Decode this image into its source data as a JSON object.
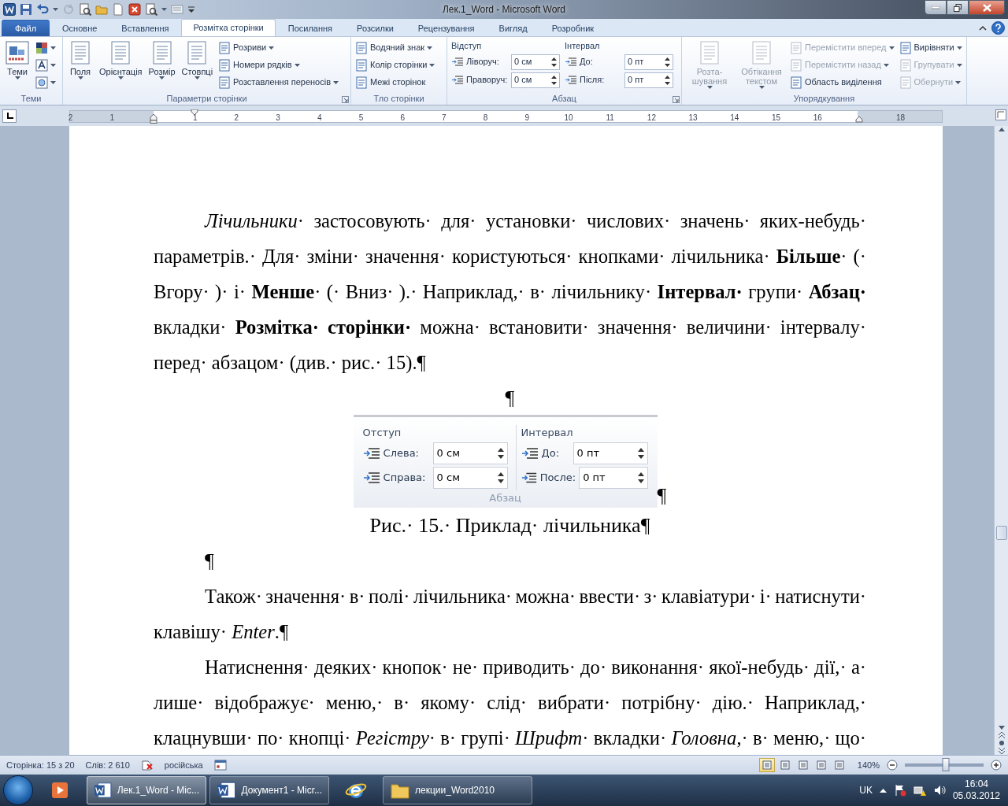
{
  "window": {
    "title": "Лек.1_Word - Microsoft Word"
  },
  "tabs": [
    {
      "label": "Файл",
      "kind": "file",
      "selected": false
    },
    {
      "label": "Основне",
      "kind": "tab",
      "selected": false
    },
    {
      "label": "Вставлення",
      "kind": "tab",
      "selected": false
    },
    {
      "label": "Розмітка сторінки",
      "kind": "tab",
      "selected": true
    },
    {
      "label": "Посилання",
      "kind": "tab",
      "selected": false
    },
    {
      "label": "Розсилки",
      "kind": "tab",
      "selected": false
    },
    {
      "label": "Рецензування",
      "kind": "tab",
      "selected": false
    },
    {
      "label": "Вигляд",
      "kind": "tab",
      "selected": false
    },
    {
      "label": "Розробник",
      "kind": "tab",
      "selected": false
    }
  ],
  "ribbon": {
    "groups": [
      {
        "label": "Теми",
        "launcher": false,
        "items": [
          {
            "kind": "large",
            "label": "Теми",
            "dropdown": true,
            "disabled": false
          },
          {
            "kind": "small",
            "dropdown": true,
            "disabled": false
          },
          {
            "kind": "small",
            "dropdown": true,
            "disabled": false
          },
          {
            "kind": "small",
            "dropdown": true,
            "disabled": false
          }
        ]
      },
      {
        "label": "Параметри сторінки",
        "launcher": true,
        "items": [
          {
            "kind": "large",
            "label": "Поля",
            "dropdown": true,
            "disabled": false
          },
          {
            "kind": "large",
            "label": "Орієнтація",
            "dropdown": true,
            "disabled": false
          },
          {
            "kind": "large",
            "label": "Розмір",
            "dropdown": true,
            "disabled": false
          },
          {
            "kind": "large",
            "label": "Стовпці",
            "dropdown": true,
            "disabled": false
          },
          {
            "kind": "small",
            "label": "Розриви",
            "dropdown": true,
            "disabled": false
          },
          {
            "kind": "small",
            "label": "Номери рядків",
            "dropdown": true,
            "disabled": false
          },
          {
            "kind": "small",
            "label": "Розставлення переносів",
            "dropdown": true,
            "disabled": false
          }
        ]
      },
      {
        "label": "Тло сторінки",
        "launcher": false,
        "items": [
          {
            "kind": "small",
            "label": "Водяний знак",
            "dropdown": true,
            "disabled": false
          },
          {
            "kind": "small",
            "label": "Колір сторінки",
            "dropdown": true,
            "disabled": false
          },
          {
            "kind": "small",
            "label": "Межі сторінок",
            "dropdown": false,
            "disabled": false
          }
        ]
      },
      {
        "label": "Абзац",
        "launcher": true,
        "items": [
          {
            "kind": "spin",
            "heading": "Відступ",
            "rows": [
              {
                "label": "Ліворуч:",
                "value": "0 см"
              },
              {
                "label": "Праворуч:",
                "value": "0 см"
              }
            ]
          },
          {
            "kind": "spin",
            "heading": "Інтервал",
            "rows": [
              {
                "label": "До:",
                "value": "0 пт"
              },
              {
                "label": "Після:",
                "value": "0 пт"
              }
            ]
          }
        ]
      },
      {
        "label": "Упорядкування",
        "launcher": false,
        "items": [
          {
            "kind": "large",
            "label": "Розта-шування",
            "dropdown": true,
            "disabled": true
          },
          {
            "kind": "large",
            "label": "Обтікання текстом",
            "dropdown": true,
            "disabled": true
          },
          {
            "kind": "small",
            "label": "Перемістити вперед",
            "dropdown": true,
            "disabled": true
          },
          {
            "kind": "small",
            "label": "Перемістити назад",
            "dropdown": true,
            "disabled": true
          },
          {
            "kind": "small",
            "label": "Область виділення",
            "dropdown": false,
            "disabled": false
          },
          {
            "kind": "small",
            "label": "Вирівняти",
            "dropdown": true,
            "disabled": false
          },
          {
            "kind": "small",
            "label": "Групувати",
            "dropdown": true,
            "disabled": true
          },
          {
            "kind": "small",
            "label": "Обернути",
            "dropdown": true,
            "disabled": true
          }
        ]
      }
    ]
  },
  "ruler": {
    "labels": [
      "2",
      "1",
      "1",
      "2",
      "3",
      "4",
      "5",
      "6",
      "7",
      "8",
      "9",
      "10",
      "11",
      "12",
      "13",
      "14",
      "15",
      "16",
      "18"
    ]
  },
  "document": {
    "paragraphs": [
      {
        "kind": "body",
        "continues": false,
        "lines": [
          "*Лічильники*· застосовують· для· установки· числових· значень· яких-небудь·",
          "параметрів.· Для· зміни· значення· користуються· кнопками· лічильника· **Більше**· (·",
          "Вгору· )· і· **Менше**· (· Вниз· ).· Наприклад,· в· лічильнику· **Інтервал·** групи· **Абзац·**",
          "вкладки· **Розмітка· сторінки·** можна· встановити· значення· величини· інтервалу·",
          "перед· абзацом· (див.· рис.· 15).¶"
        ]
      },
      {
        "kind": "mark",
        "text": "¶"
      },
      {
        "kind": "figure",
        "mark": "¶",
        "group_label": "Абзац",
        "columns": [
          {
            "heading": "Отступ",
            "rows": [
              {
                "label": "Слева:",
                "value": "0 см"
              },
              {
                "label": "Справа:",
                "value": "0 см"
              }
            ]
          },
          {
            "heading": "Интервал",
            "rows": [
              {
                "label": "До:",
                "value": "0 пт"
              },
              {
                "label": "После:",
                "value": "0 пт"
              }
            ]
          }
        ]
      },
      {
        "kind": "caption",
        "text": "Рис.· 15.· Приклад· лічильника¶"
      },
      {
        "kind": "indent_mark",
        "text": "¶"
      },
      {
        "kind": "body",
        "continues": false,
        "lines": [
          "Також· значення· в· полі· лічильника· можна· ввести· з· клавіатури· і· натиснути·",
          "клавішу· *Enter*.¶"
        ]
      },
      {
        "kind": "body",
        "continues": true,
        "lines": [
          "Натиснення· деяких· кнопок· не· приводить· до· виконання· якої-небудь· дії,· а·",
          "лише· відображує· меню,· в· якому· слід· вибрати· потрібну· дію.· Наприклад,·",
          "клацнувши· по· кнопці· *Регістру*· в· групі· *Шрифт*· вкладки· *Головна*,· в· меню,· що·"
        ]
      }
    ]
  },
  "status_bar": {
    "page": "Сторінка: 15 з 20",
    "words": "Слів: 2 610",
    "language": "російська",
    "views": [
      {
        "selected": true
      },
      {
        "selected": false
      },
      {
        "selected": false
      },
      {
        "selected": false
      },
      {
        "selected": false
      }
    ],
    "zoom": {
      "label": "140%",
      "level": 0.52
    }
  },
  "taskbar": {
    "items": [
      {
        "kind": "window",
        "label": "Лек.1_Word - Mic...",
        "selected": true
      },
      {
        "kind": "window",
        "label": "Документ1 - Micr...",
        "selected": false
      },
      {
        "kind": "browser",
        "selected": false
      },
      {
        "kind": "folder",
        "label": "лекции_Word2010",
        "selected": false
      }
    ],
    "language": "UK",
    "time": "16:04",
    "date": "05.03.2012"
  }
}
